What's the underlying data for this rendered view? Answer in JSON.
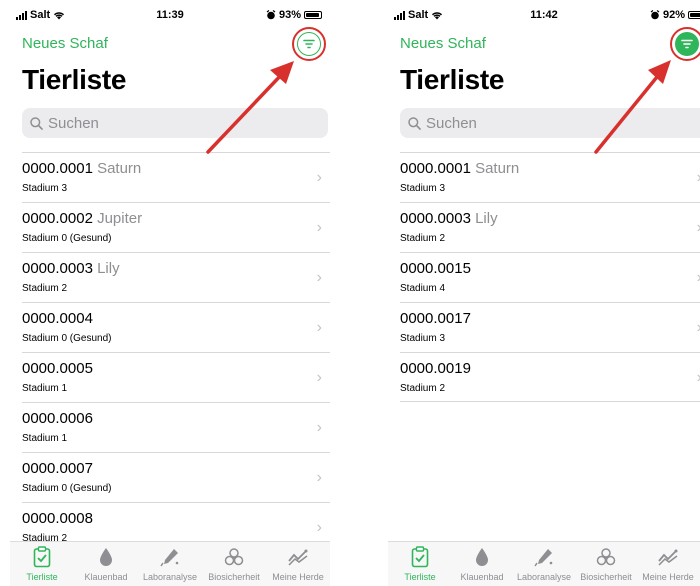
{
  "colors": {
    "accent": "#2fb55a",
    "annotation": "#d8312d",
    "secondary_text": "#8e8e93"
  },
  "screens": [
    {
      "status": {
        "carrier": "Salt",
        "time": "11:39",
        "battery": "93%",
        "battery_level": 0.93
      },
      "nav": {
        "left_button": "Neues Schaf",
        "filter_icon": "filter-icon",
        "filter_active": false
      },
      "title": "Tierliste",
      "search": {
        "placeholder": "Suchen"
      },
      "rows": [
        {
          "id": "0000.0001",
          "name": "Saturn",
          "stage": "Stadium 3"
        },
        {
          "id": "0000.0002",
          "name": "Jupiter",
          "stage": "Stadium 0 (Gesund)"
        },
        {
          "id": "0000.0003",
          "name": "Lily",
          "stage": "Stadium 2"
        },
        {
          "id": "0000.0004",
          "name": "",
          "stage": "Stadium 0 (Gesund)"
        },
        {
          "id": "0000.0005",
          "name": "",
          "stage": "Stadium 1"
        },
        {
          "id": "0000.0006",
          "name": "",
          "stage": "Stadium 1"
        },
        {
          "id": "0000.0007",
          "name": "",
          "stage": "Stadium 0 (Gesund)"
        },
        {
          "id": "0000.0008",
          "name": "",
          "stage": "Stadium 2"
        }
      ],
      "tabs": [
        {
          "label": "Tierliste",
          "icon": "clipboard-check-icon",
          "active": true
        },
        {
          "label": "Klauenbad",
          "icon": "drop-icon",
          "active": false
        },
        {
          "label": "Laboranalyse",
          "icon": "pipette-icon",
          "active": false
        },
        {
          "label": "Biosicherheit",
          "icon": "biohazard-icon",
          "active": false
        },
        {
          "label": "Meine Herde",
          "icon": "chart-line-icon",
          "active": false
        }
      ]
    },
    {
      "status": {
        "carrier": "Salt",
        "time": "11:42",
        "battery": "92%",
        "battery_level": 0.92
      },
      "nav": {
        "left_button": "Neues Schaf",
        "filter_icon": "filter-icon",
        "filter_active": true
      },
      "title": "Tierliste",
      "search": {
        "placeholder": "Suchen"
      },
      "rows": [
        {
          "id": "0000.0001",
          "name": "Saturn",
          "stage": "Stadium 3"
        },
        {
          "id": "0000.0003",
          "name": "Lily",
          "stage": "Stadium 2"
        },
        {
          "id": "0000.0015",
          "name": "",
          "stage": "Stadium 4"
        },
        {
          "id": "0000.0017",
          "name": "",
          "stage": "Stadium 3"
        },
        {
          "id": "0000.0019",
          "name": "",
          "stage": "Stadium 2"
        }
      ],
      "tabs": [
        {
          "label": "Tierliste",
          "icon": "clipboard-check-icon",
          "active": true
        },
        {
          "label": "Klauenbad",
          "icon": "drop-icon",
          "active": false
        },
        {
          "label": "Laboranalyse",
          "icon": "pipette-icon",
          "active": false
        },
        {
          "label": "Biosicherheit",
          "icon": "biohazard-icon",
          "active": false
        },
        {
          "label": "Meine Herde",
          "icon": "chart-line-icon",
          "active": false
        }
      ]
    }
  ]
}
